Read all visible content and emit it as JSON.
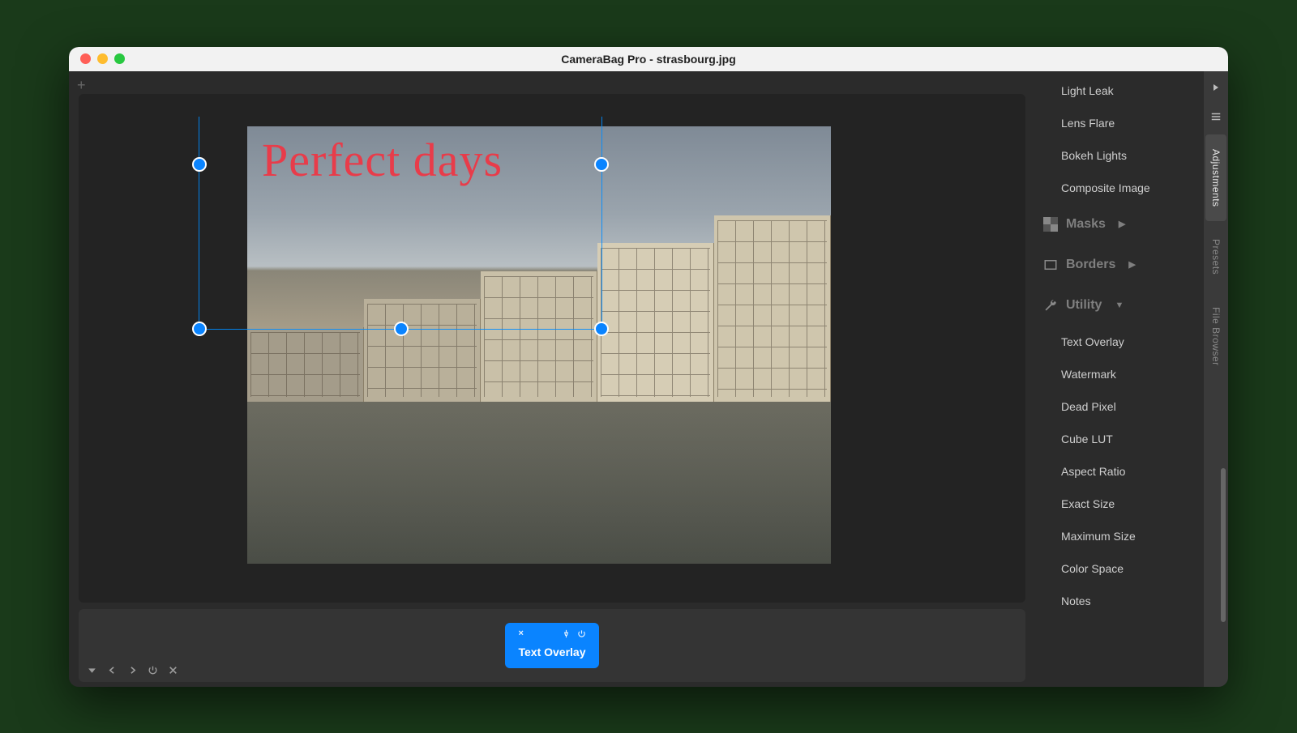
{
  "window": {
    "title": "CameraBag Pro - strasbourg.jpg"
  },
  "overlay_text": "Perfect days",
  "tile": {
    "label": "Text Overlay",
    "close": "×",
    "pin": "📌",
    "power": "⏻"
  },
  "tabs": {
    "adjustments": "Adjustments",
    "presets": "Presets",
    "file_browser": "File Browser"
  },
  "side": {
    "group_top": [
      "Light Leak",
      "Lens Flare",
      "Bokeh Lights",
      "Composite Image"
    ],
    "masks_label": "Masks",
    "borders_label": "Borders",
    "utility_label": "Utility",
    "utility_items": [
      "Text Overlay",
      "Watermark",
      "Dead Pixel",
      "Cube LUT",
      "Aspect Ratio",
      "Exact Size",
      "Maximum Size",
      "Color Space",
      "Notes"
    ]
  }
}
